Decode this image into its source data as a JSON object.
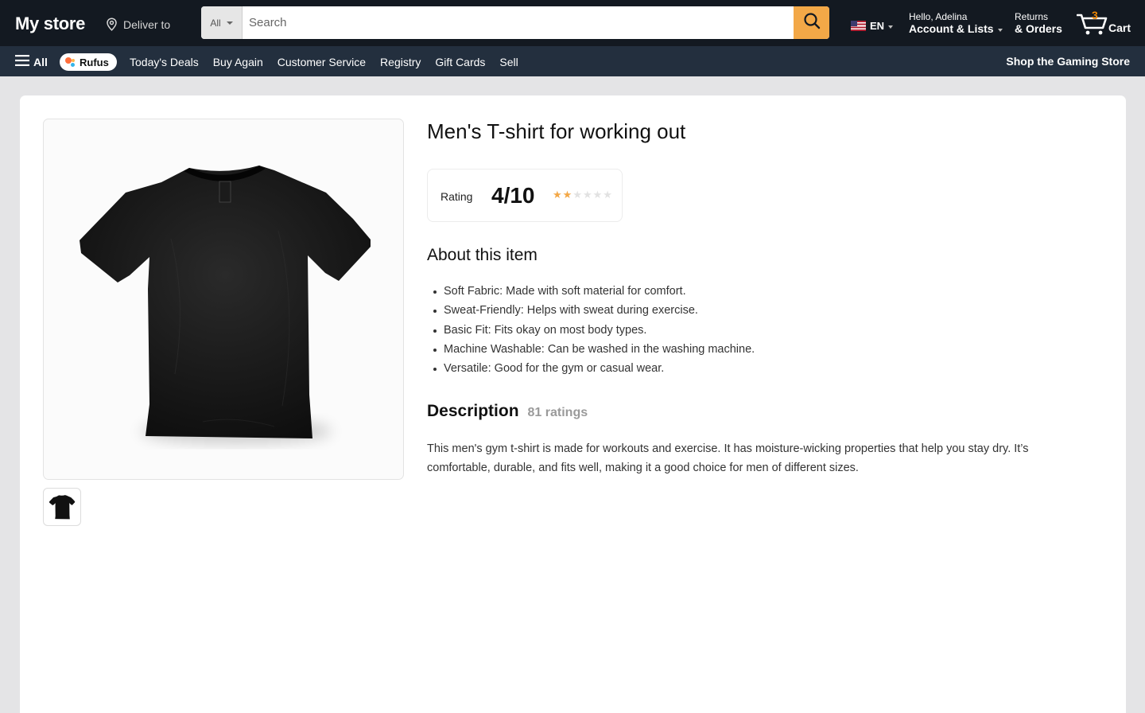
{
  "header": {
    "logo": "My store",
    "deliver_label": "Deliver to",
    "search_category": "All",
    "search_placeholder": "Search",
    "language": "EN",
    "account_greeting": "Hello, Adelina",
    "account_label": "Account & Lists",
    "returns_line1": "Returns",
    "returns_line2": "& Orders",
    "cart_count": "3",
    "cart_label": "Cart",
    "icons": {
      "location": "location-pin-icon",
      "search": "magnifier-icon",
      "flag": "us-flag-icon",
      "cart": "shopping-cart-icon"
    }
  },
  "nav": {
    "all_label": "All",
    "rufus_label": "Rufus",
    "links": [
      "Today's Deals",
      "Buy Again",
      "Customer Service",
      "Registry",
      "Gift Cards",
      "Sell"
    ],
    "promo": "Shop the Gaming Store"
  },
  "product": {
    "title": "Men's T-shirt for working out",
    "rating_label": "Rating",
    "rating_value": "4/10",
    "stars_filled": 2,
    "stars_total": 6,
    "about_heading": "About this item",
    "bullets": [
      "Soft Fabric: Made with soft material for comfort.",
      "Sweat-Friendly: Helps with sweat during exercise.",
      "Basic Fit: Fits okay on most body types.",
      "Machine Washable: Can be washed in the washing machine.",
      "Versatile: Good for the gym or casual wear."
    ],
    "description_heading": "Description",
    "ratings_count": "81 ratings",
    "description": "This men's gym t-shirt is made for workouts and exercise. It has moisture-wicking properties that help you stay dry. It’s comfortable, durable, and fits well, making it a good choice for men of different sizes."
  },
  "colors": {
    "header_bg": "#131921",
    "nav_bg": "#232f3e",
    "search_button": "#f3a847",
    "cart_count": "#f08804",
    "star_filled": "#f3a847",
    "star_empty": "#e2e2e2"
  }
}
